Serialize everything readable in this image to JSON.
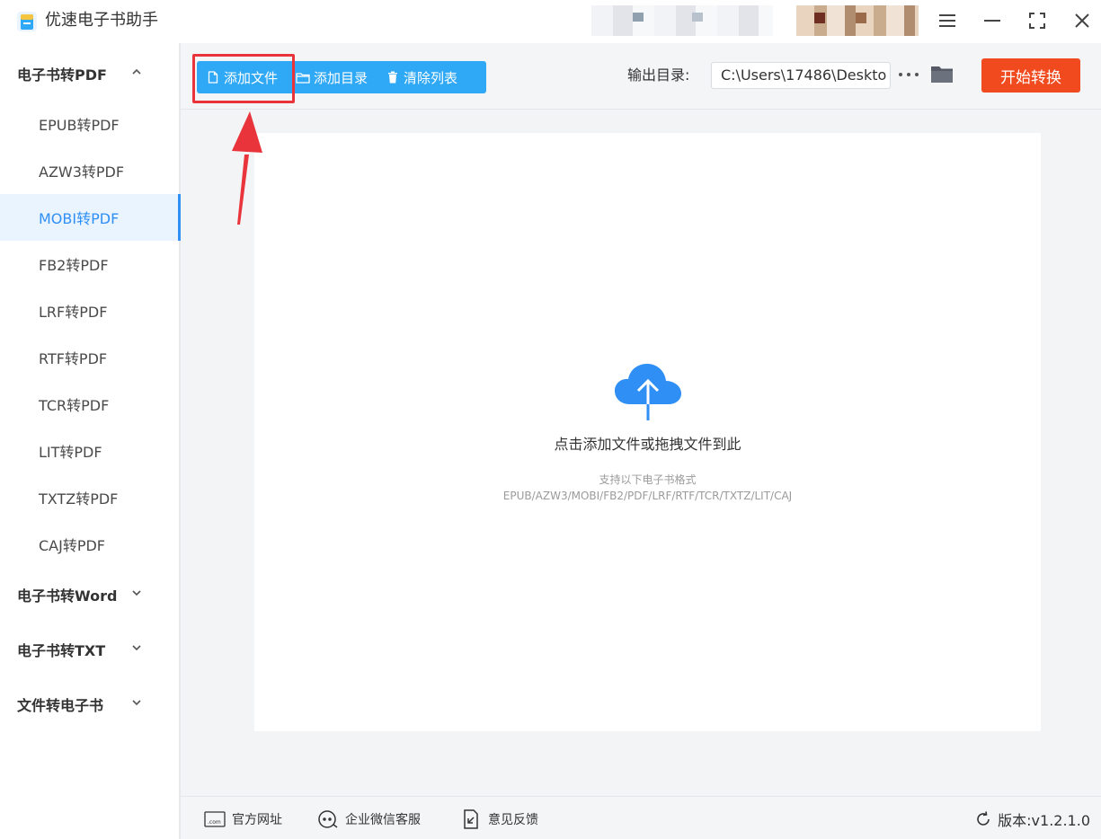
{
  "app": {
    "title": "优速电子书助手"
  },
  "sidebar": {
    "groups": [
      {
        "label": "电子书转PDF",
        "expanded": true
      },
      {
        "label": "电子书转Word",
        "expanded": false
      },
      {
        "label": "电子书转TXT",
        "expanded": false
      },
      {
        "label": "文件转电子书",
        "expanded": false
      }
    ],
    "items": [
      {
        "label": "EPUB转PDF"
      },
      {
        "label": "AZW3转PDF"
      },
      {
        "label": "MOBI转PDF",
        "active": true
      },
      {
        "label": "FB2转PDF"
      },
      {
        "label": "LRF转PDF"
      },
      {
        "label": "RTF转PDF"
      },
      {
        "label": "TCR转PDF"
      },
      {
        "label": "LIT转PDF"
      },
      {
        "label": "TXTZ转PDF"
      },
      {
        "label": "CAJ转PDF"
      }
    ]
  },
  "toolbar": {
    "add_file": "添加文件",
    "add_folder": "添加目录",
    "clear_list": "清除列表",
    "output_label": "输出目录:",
    "output_path": "C:\\Users\\17486\\Deskto",
    "start": "开始转换"
  },
  "dropzone": {
    "main_text": "点击添加文件或拖拽文件到此",
    "sub_text": "支持以下电子书格式",
    "formats": "EPUB/AZW3/MOBI/FB2/PDF/LRF/RTF/TCR/TXTZ/LIT/CAJ"
  },
  "footer": {
    "website": "官方网址",
    "wechat": "企业微信客服",
    "feedback": "意见反馈",
    "version": "版本:v1.2.1.0"
  },
  "colors": {
    "accent": "#2f8ff5",
    "toolbar_button": "#2fa8f5",
    "start_button": "#f04a1e",
    "annotation": "#e8343a"
  }
}
